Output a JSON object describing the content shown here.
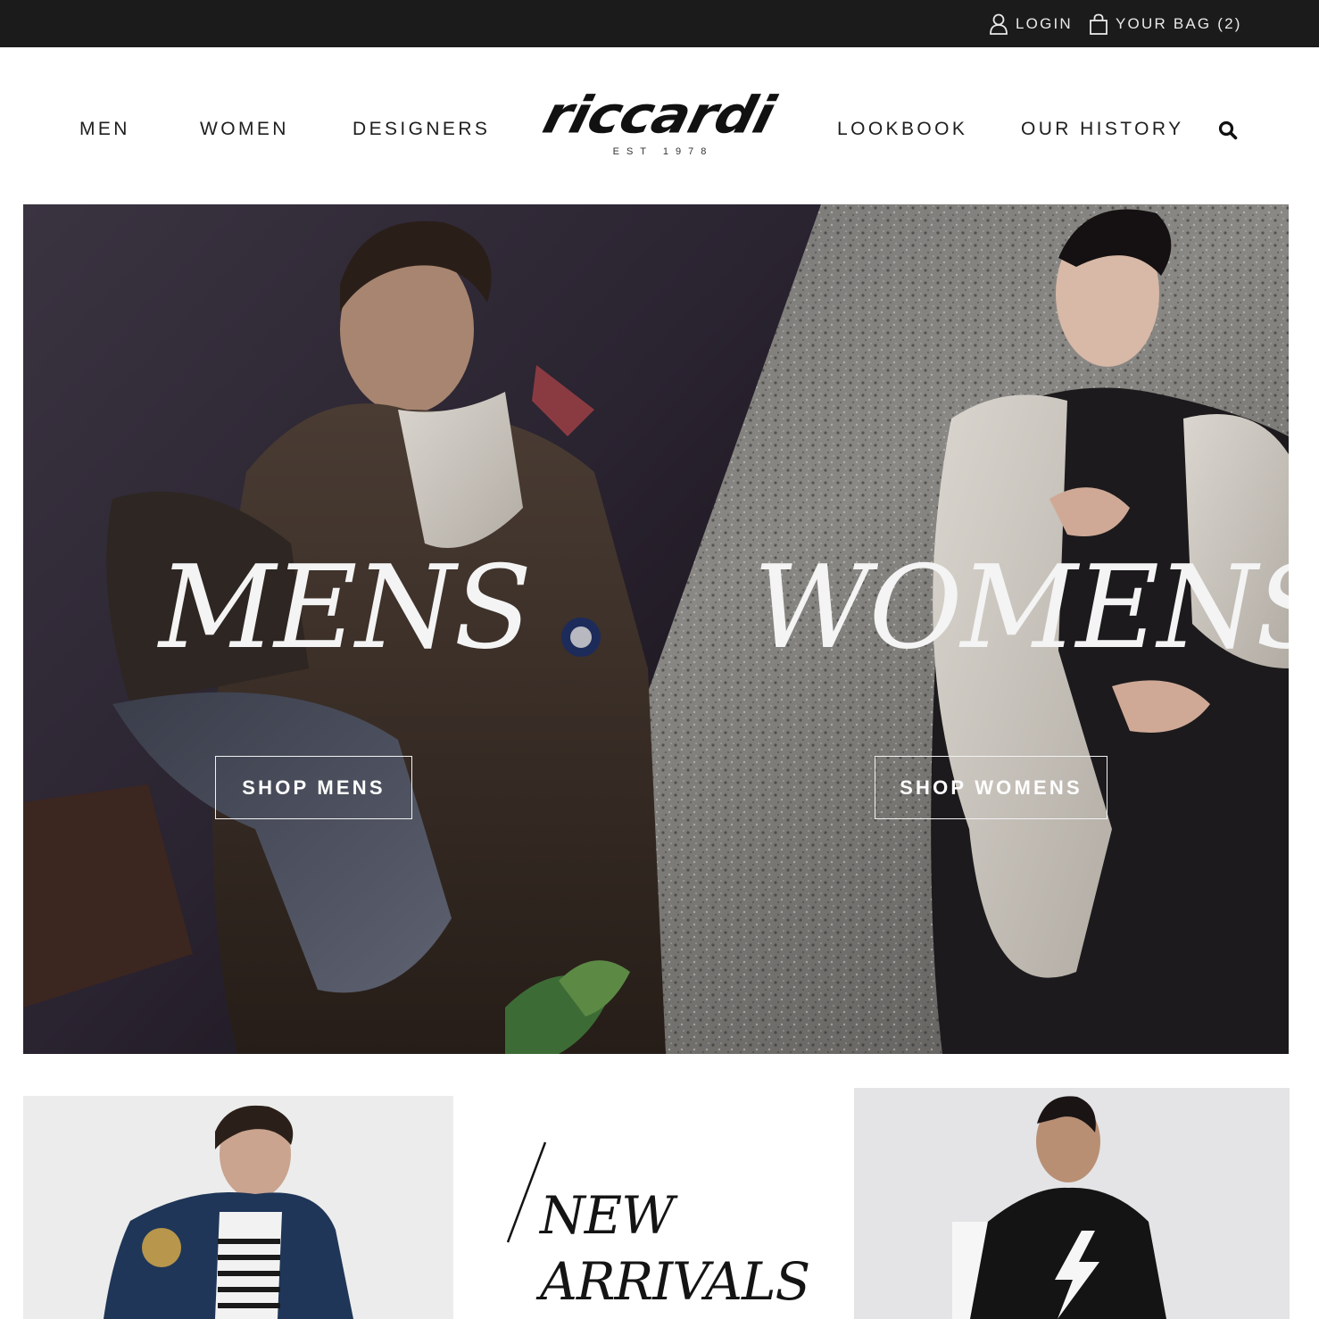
{
  "topbar": {
    "login_label": "LOGIN",
    "bag_label": "YOUR BAG (2)"
  },
  "nav": {
    "left": [
      "MEN",
      "WOMEN",
      "DESIGNERS"
    ],
    "right": [
      "LOOKBOOK",
      "OUR HISTORY"
    ],
    "search_icon": "search-icon"
  },
  "brand": {
    "logo": "riccardi",
    "tagline": "EST 1978"
  },
  "hero": {
    "mens_title": "MENS",
    "womens_title": "WOMENS",
    "shop_mens": "SHOP MENS",
    "shop_womens": "SHOP WOMENS"
  },
  "promo": {
    "arrivals_line1": "NEW",
    "arrivals_line2": "ARRIVALS"
  },
  "colors": {
    "topbar_bg": "#1b1b1b",
    "text": "#1e1e1e",
    "hero_text": "#f4f4f4"
  }
}
